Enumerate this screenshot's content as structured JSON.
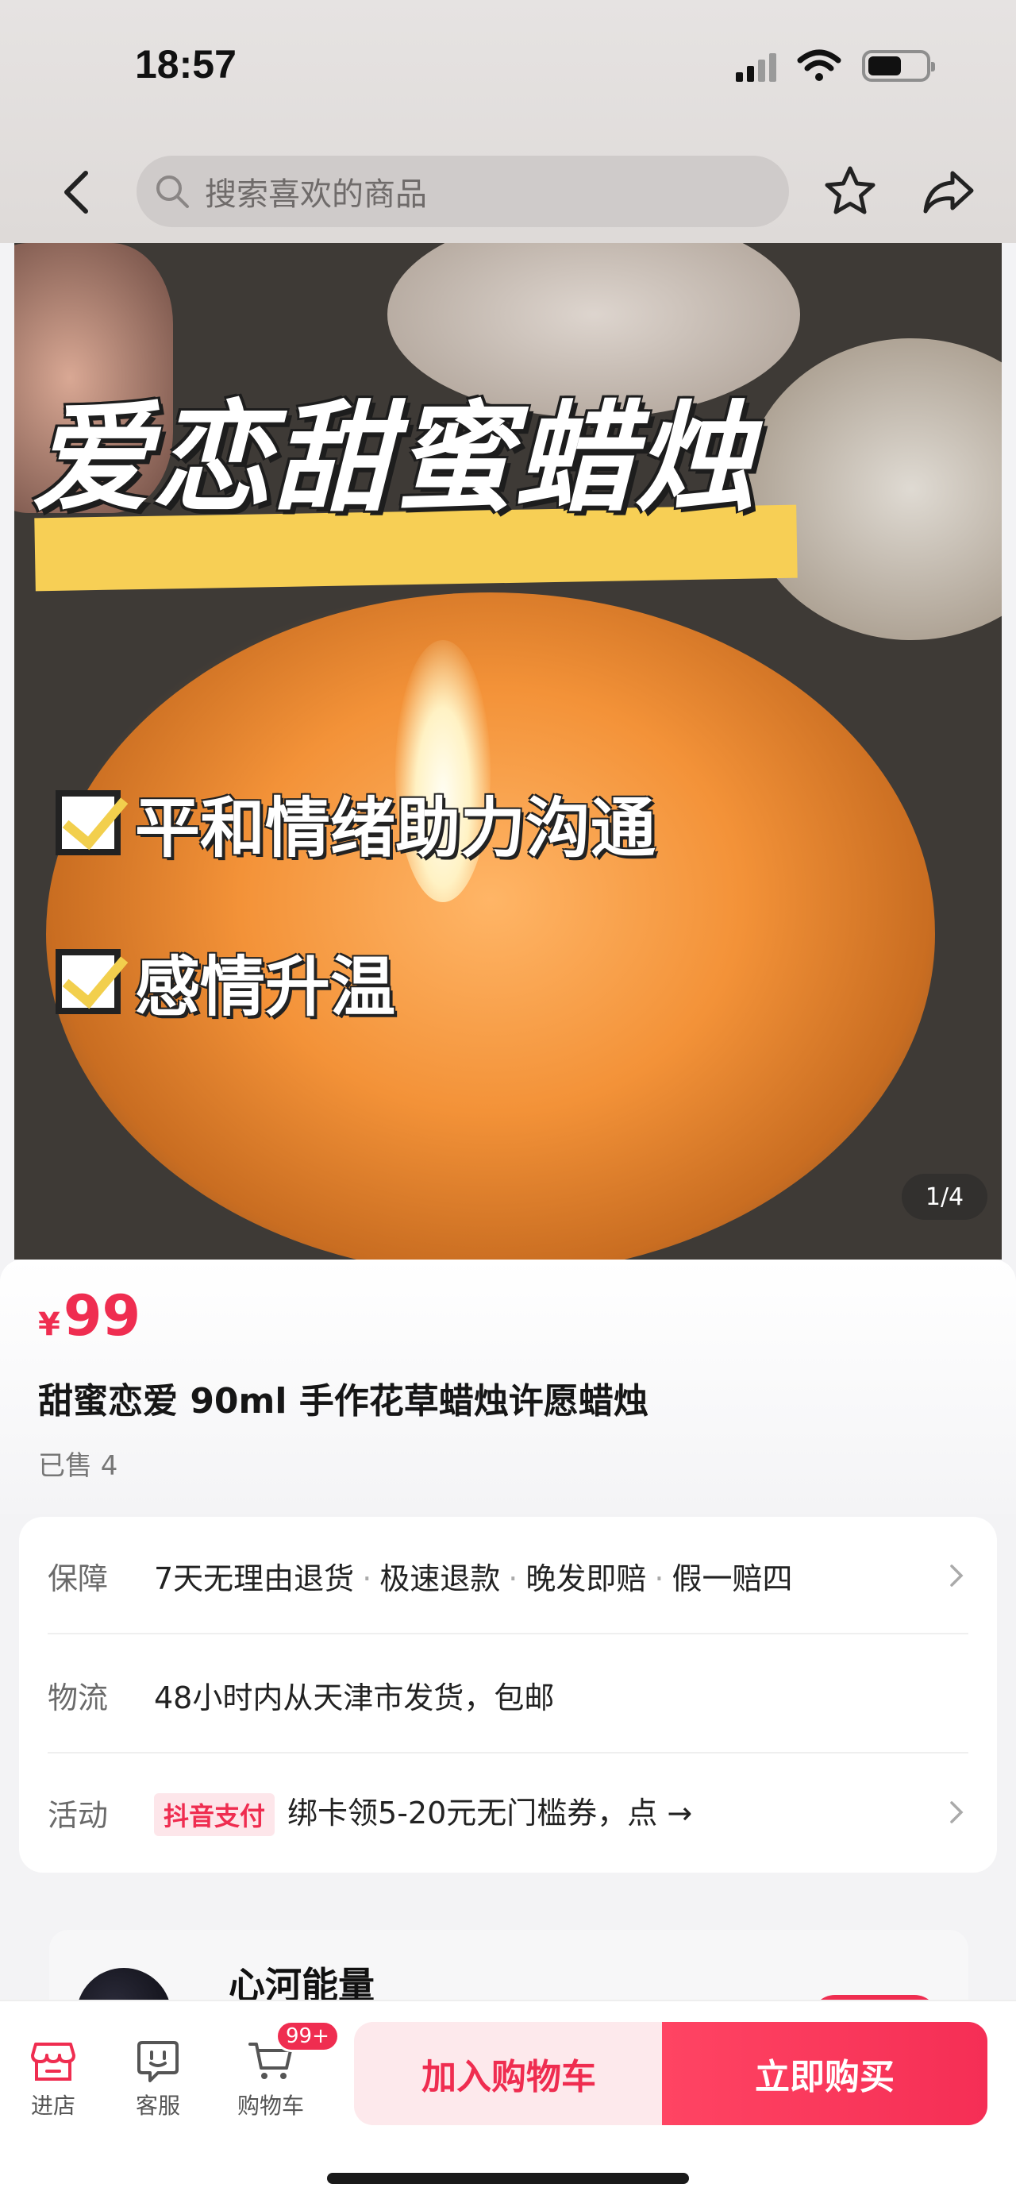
{
  "status_bar": {
    "time": "18:57"
  },
  "header": {
    "search_placeholder": "搜索喜欢的商品"
  },
  "hero": {
    "headline": "爱恋甜蜜蜡烛",
    "features": [
      "平和情绪助力沟通",
      "感情升温"
    ],
    "pager": "1/4"
  },
  "product": {
    "currency": "¥",
    "price": "99",
    "title": "甜蜜恋爱 90ml 手作花草蜡烛许愿蜡烛",
    "sold": "已售 4"
  },
  "info": {
    "guarantee_label": "保障",
    "guarantee_items": [
      "7天无理由退货",
      "极速退款",
      "晚发即赔",
      "假一赔四"
    ],
    "logistics_label": "物流",
    "logistics_value": "48小时内从天津市发货，包邮",
    "promo_label": "活动",
    "promo_badge": "抖音支付",
    "promo_value": "绑卡领5-20元无门槛券，点 →"
  },
  "shop": {
    "name": "心河能量"
  },
  "bottom_bar": {
    "store_label": "进店",
    "service_label": "客服",
    "cart_label": "购物车",
    "cart_badge": "99+",
    "add_to_cart": "加入购物车",
    "buy_now": "立即购买"
  },
  "colors": {
    "accent": "#ef2d50",
    "highlight": "#f7cf55"
  }
}
